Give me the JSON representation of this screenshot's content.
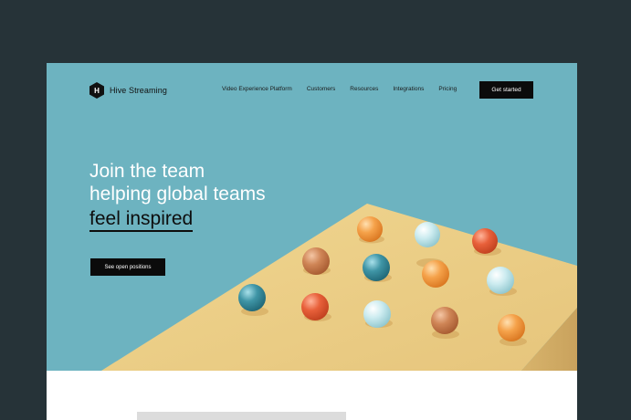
{
  "nav": {
    "logo_letter": "H",
    "brand": "Hive Streaming",
    "links": [
      "Video Experience Platform",
      "Customers",
      "Resources",
      "Integrations",
      "Pricing"
    ],
    "cta": "Get started"
  },
  "hero": {
    "headline_line1": "Join the team",
    "headline_line2": "helping global teams",
    "headline_accent": "feel inspired",
    "cta": "See open positions"
  },
  "colors": {
    "frame_background": "#263338",
    "hero_background": "#6db3c0",
    "table_surface": "#ecd08a",
    "button": "#0b0b0b"
  }
}
